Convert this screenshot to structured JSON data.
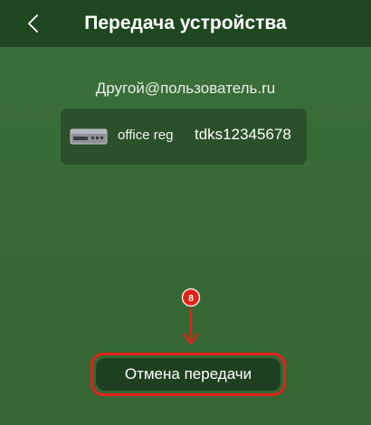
{
  "header": {
    "title": "Передача устройства",
    "back_icon": "chevron-left-icon"
  },
  "recipient": {
    "email": "Другой@пользователь.ru"
  },
  "device": {
    "icon": "dvr-recorder-icon",
    "name": "office reg",
    "serial": "tdks12345678"
  },
  "annotation": {
    "step": "8",
    "color": "#e2231a"
  },
  "actions": {
    "cancel_label": "Отмена передачи"
  }
}
